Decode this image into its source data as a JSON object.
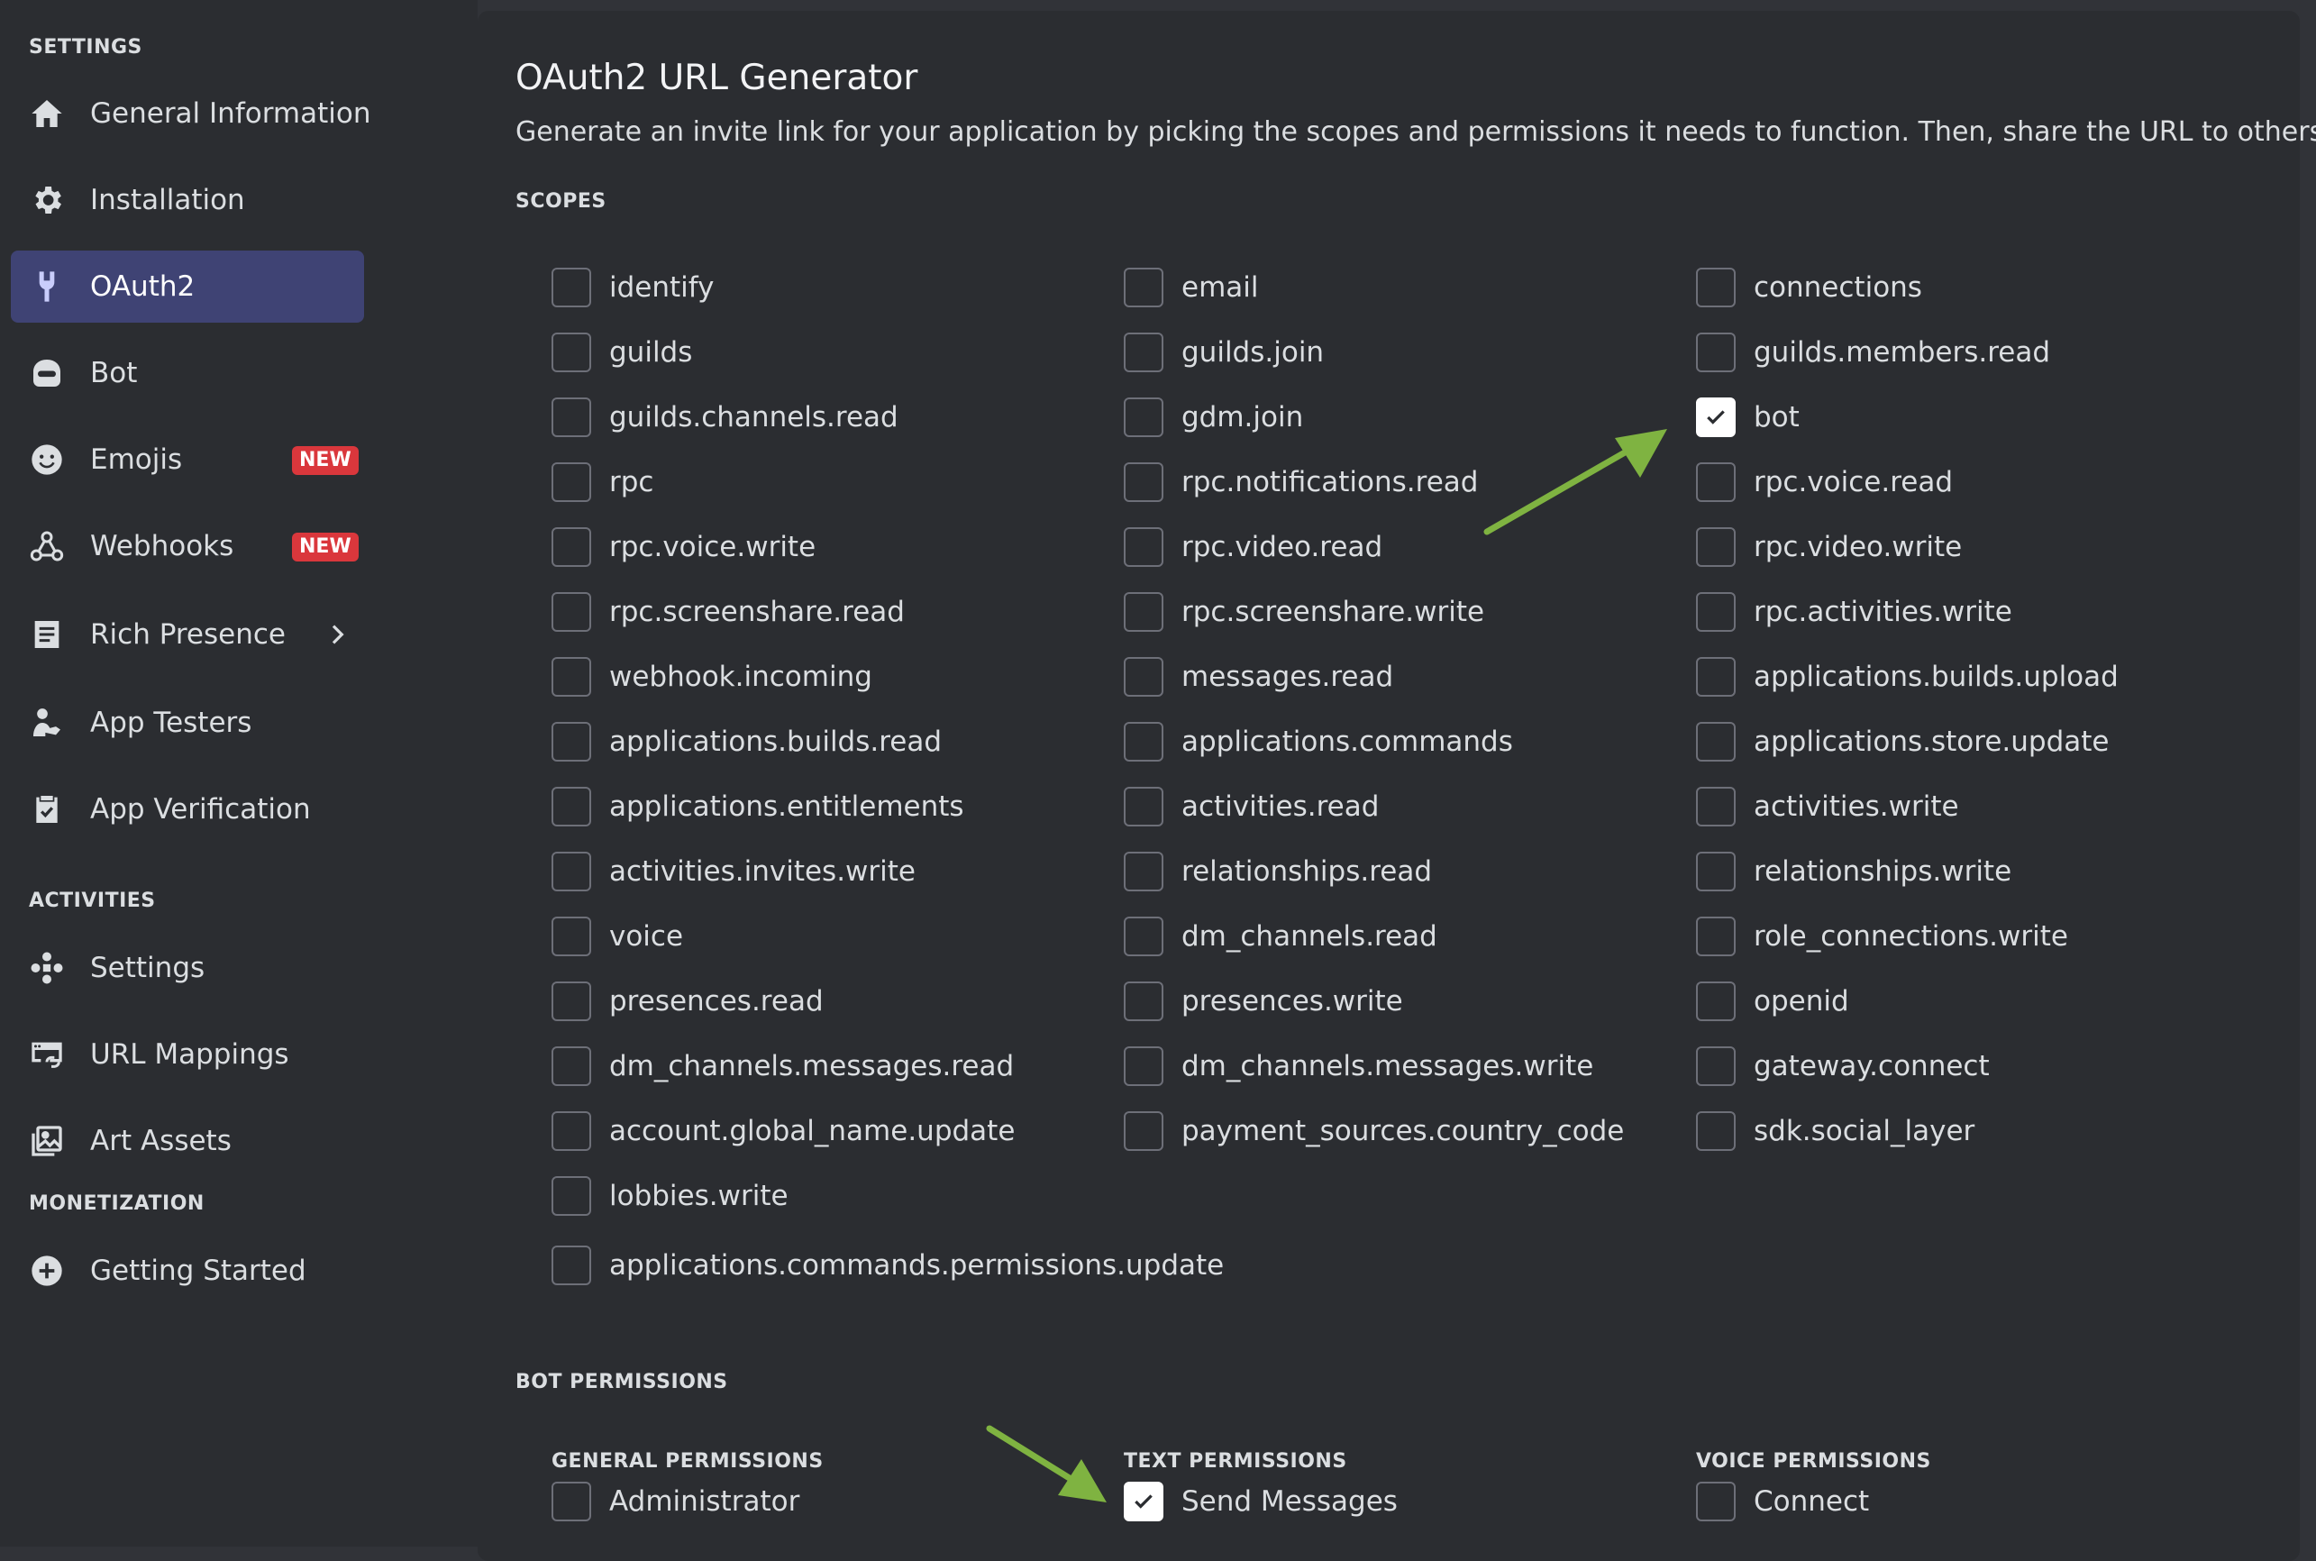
{
  "sidebar": {
    "settings_title": "SETTINGS",
    "activities_title": "ACTIVITIES",
    "monetization_title": "MONETIZATION",
    "items": [
      {
        "label": "General Information",
        "icon": "home-icon"
      },
      {
        "label": "Installation",
        "icon": "gear-icon"
      },
      {
        "label": "OAuth2",
        "icon": "wrench-icon",
        "selected": true
      },
      {
        "label": "Bot",
        "icon": "bot-icon"
      },
      {
        "label": "Emojis",
        "icon": "emoji-icon",
        "badge": "NEW"
      },
      {
        "label": "Webhooks",
        "icon": "webhook-icon",
        "badge": "NEW"
      },
      {
        "label": "Rich Presence",
        "icon": "document-icon"
      },
      {
        "label": "App Testers",
        "icon": "tester-icon"
      },
      {
        "label": "App Verification",
        "icon": "clipboard-check-icon"
      },
      {
        "label": "Settings",
        "icon": "activity-settings-icon"
      },
      {
        "label": "URL Mappings",
        "icon": "url-mapping-icon"
      },
      {
        "label": "Art Assets",
        "icon": "image-icon"
      },
      {
        "label": "Getting Started",
        "icon": "plus-circle-icon"
      }
    ]
  },
  "main": {
    "title": "OAuth2 URL Generator",
    "description": "Generate an invite link for your application by picking the scopes and permissions it needs to function. Then, share the URL to others!",
    "scopes_title": "SCOPES",
    "scopes": [
      {
        "label": "identify",
        "checked": false
      },
      {
        "label": "email",
        "checked": false
      },
      {
        "label": "connections",
        "checked": false
      },
      {
        "label": "guilds",
        "checked": false
      },
      {
        "label": "guilds.join",
        "checked": false
      },
      {
        "label": "guilds.members.read",
        "checked": false
      },
      {
        "label": "guilds.channels.read",
        "checked": false
      },
      {
        "label": "gdm.join",
        "checked": false
      },
      {
        "label": "bot",
        "checked": true
      },
      {
        "label": "rpc",
        "checked": false
      },
      {
        "label": "rpc.notifications.read",
        "checked": false
      },
      {
        "label": "rpc.voice.read",
        "checked": false
      },
      {
        "label": "rpc.voice.write",
        "checked": false
      },
      {
        "label": "rpc.video.read",
        "checked": false
      },
      {
        "label": "rpc.video.write",
        "checked": false
      },
      {
        "label": "rpc.screenshare.read",
        "checked": false
      },
      {
        "label": "rpc.screenshare.write",
        "checked": false
      },
      {
        "label": "rpc.activities.write",
        "checked": false
      },
      {
        "label": "webhook.incoming",
        "checked": false
      },
      {
        "label": "messages.read",
        "checked": false
      },
      {
        "label": "applications.builds.upload",
        "checked": false
      },
      {
        "label": "applications.builds.read",
        "checked": false
      },
      {
        "label": "applications.commands",
        "checked": false
      },
      {
        "label": "applications.store.update",
        "checked": false
      },
      {
        "label": "applications.entitlements",
        "checked": false
      },
      {
        "label": "activities.read",
        "checked": false
      },
      {
        "label": "activities.write",
        "checked": false
      },
      {
        "label": "activities.invites.write",
        "checked": false
      },
      {
        "label": "relationships.read",
        "checked": false
      },
      {
        "label": "relationships.write",
        "checked": false
      },
      {
        "label": "voice",
        "checked": false
      },
      {
        "label": "dm_channels.read",
        "checked": false
      },
      {
        "label": "role_connections.write",
        "checked": false
      },
      {
        "label": "presences.read",
        "checked": false
      },
      {
        "label": "presences.write",
        "checked": false
      },
      {
        "label": "openid",
        "checked": false
      },
      {
        "label": "dm_channels.messages.read",
        "checked": false
      },
      {
        "label": "dm_channels.messages.write",
        "checked": false
      },
      {
        "label": "gateway.connect",
        "checked": false
      },
      {
        "label": "account.global_name.update",
        "checked": false
      },
      {
        "label": "payment_sources.country_code",
        "checked": false
      },
      {
        "label": "sdk.social_layer",
        "checked": false
      },
      {
        "label": "lobbies.write",
        "checked": false
      }
    ],
    "extra_scope": {
      "label": "applications.commands.permissions.update",
      "checked": false
    },
    "bot_permissions_title": "BOT PERMISSIONS",
    "permission_groups": [
      {
        "title": "GENERAL PERMISSIONS",
        "items": [
          {
            "label": "Administrator",
            "checked": false
          }
        ]
      },
      {
        "title": "TEXT PERMISSIONS",
        "items": [
          {
            "label": "Send Messages",
            "checked": true
          }
        ]
      },
      {
        "title": "VOICE PERMISSIONS",
        "items": [
          {
            "label": "Connect",
            "checked": false
          }
        ]
      }
    ]
  },
  "colors": {
    "background": "#313338",
    "panel": "#2b2d31",
    "selected_nav": "#3f4374",
    "badge": "#da373c",
    "annotation_arrow": "#7fb341"
  }
}
